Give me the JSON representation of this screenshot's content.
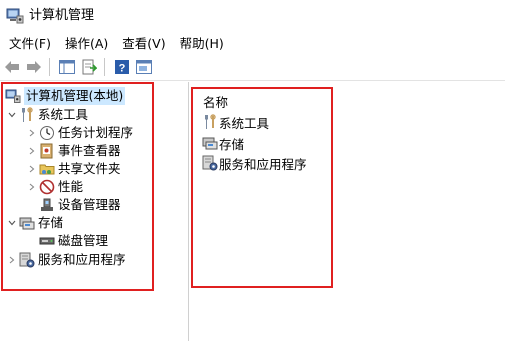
{
  "window": {
    "title": "计算机管理"
  },
  "menu": {
    "items": [
      {
        "label": "文件(F)"
      },
      {
        "label": "操作(A)"
      },
      {
        "label": "查看(V)"
      },
      {
        "label": "帮助(H)"
      }
    ]
  },
  "toolbar": {
    "icons": [
      "back-arrow-icon",
      "forward-arrow-icon",
      "show-hide-console-tree-icon",
      "export-list-icon",
      "help-icon",
      "properties-icon"
    ]
  },
  "tree": {
    "root": {
      "label": "计算机管理(本地)",
      "icon": "computer-management-icon",
      "selected": true
    },
    "system_tools": {
      "label": "系统工具",
      "icon": "tools-icon",
      "expanded": true
    },
    "task_scheduler": {
      "label": "任务计划程序",
      "icon": "clock-icon"
    },
    "event_viewer": {
      "label": "事件查看器",
      "icon": "event-viewer-icon"
    },
    "shared_folders": {
      "label": "共享文件夹",
      "icon": "shared-folder-icon"
    },
    "performance": {
      "label": "性能",
      "icon": "performance-icon"
    },
    "device_manager": {
      "label": "设备管理器",
      "icon": "device-manager-icon"
    },
    "storage": {
      "label": "存储",
      "icon": "storage-icon",
      "expanded": true
    },
    "disk_management": {
      "label": "磁盘管理",
      "icon": "disk-icon"
    },
    "services_apps": {
      "label": "服务和应用程序",
      "icon": "services-icon"
    }
  },
  "list": {
    "header": "名称",
    "rows": [
      {
        "label": "系统工具",
        "icon": "tools-icon"
      },
      {
        "label": "存储",
        "icon": "storage-icon"
      },
      {
        "label": "服务和应用程序",
        "icon": "services-icon"
      }
    ]
  },
  "colors": {
    "annotation_red": "#e02020",
    "selection": "#cce8ff"
  }
}
